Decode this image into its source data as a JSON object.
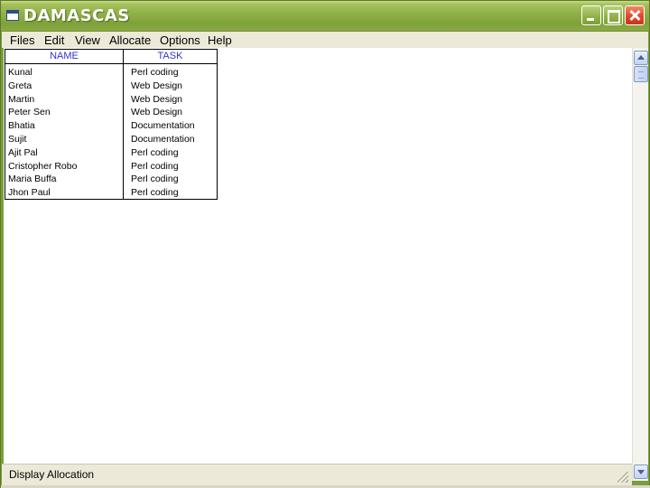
{
  "window": {
    "title": "DAMASCAS",
    "accent_color": "#7ea23a",
    "close_color": "#e0482a"
  },
  "menu": {
    "items": [
      "Files",
      "Edit",
      "View",
      "Allocate",
      "Options",
      "Help"
    ]
  },
  "table": {
    "headers": {
      "name": "NAME",
      "task": "TASK"
    },
    "header_color": "#3333cc",
    "rows": [
      {
        "name": "Kunal",
        "task": "Perl coding"
      },
      {
        "name": "Greta",
        "task": "Web Design"
      },
      {
        "name": "Martin",
        "task": "Web Design"
      },
      {
        "name": "Peter Sen",
        "task": "Web Design"
      },
      {
        "name": "Bhatia",
        "task": "Documentation"
      },
      {
        "name": "Sujit",
        "task": "Documentation"
      },
      {
        "name": "Ajit Pal",
        "task": "Perl coding"
      },
      {
        "name": "Cristopher Robo",
        "task": "Perl coding"
      },
      {
        "name": "Maria Buffa",
        "task": "Perl coding"
      },
      {
        "name": "Jhon Paul",
        "task": "Perl coding"
      }
    ]
  },
  "status": {
    "text": "Display Allocation"
  },
  "icons": {
    "app": "window-app-icon",
    "minimize": "minimize-icon",
    "maximize": "maximize-icon",
    "close": "close-icon",
    "scroll_up": "chevron-up-icon",
    "scroll_down": "chevron-down-icon",
    "resize": "resize-grip-icon"
  }
}
